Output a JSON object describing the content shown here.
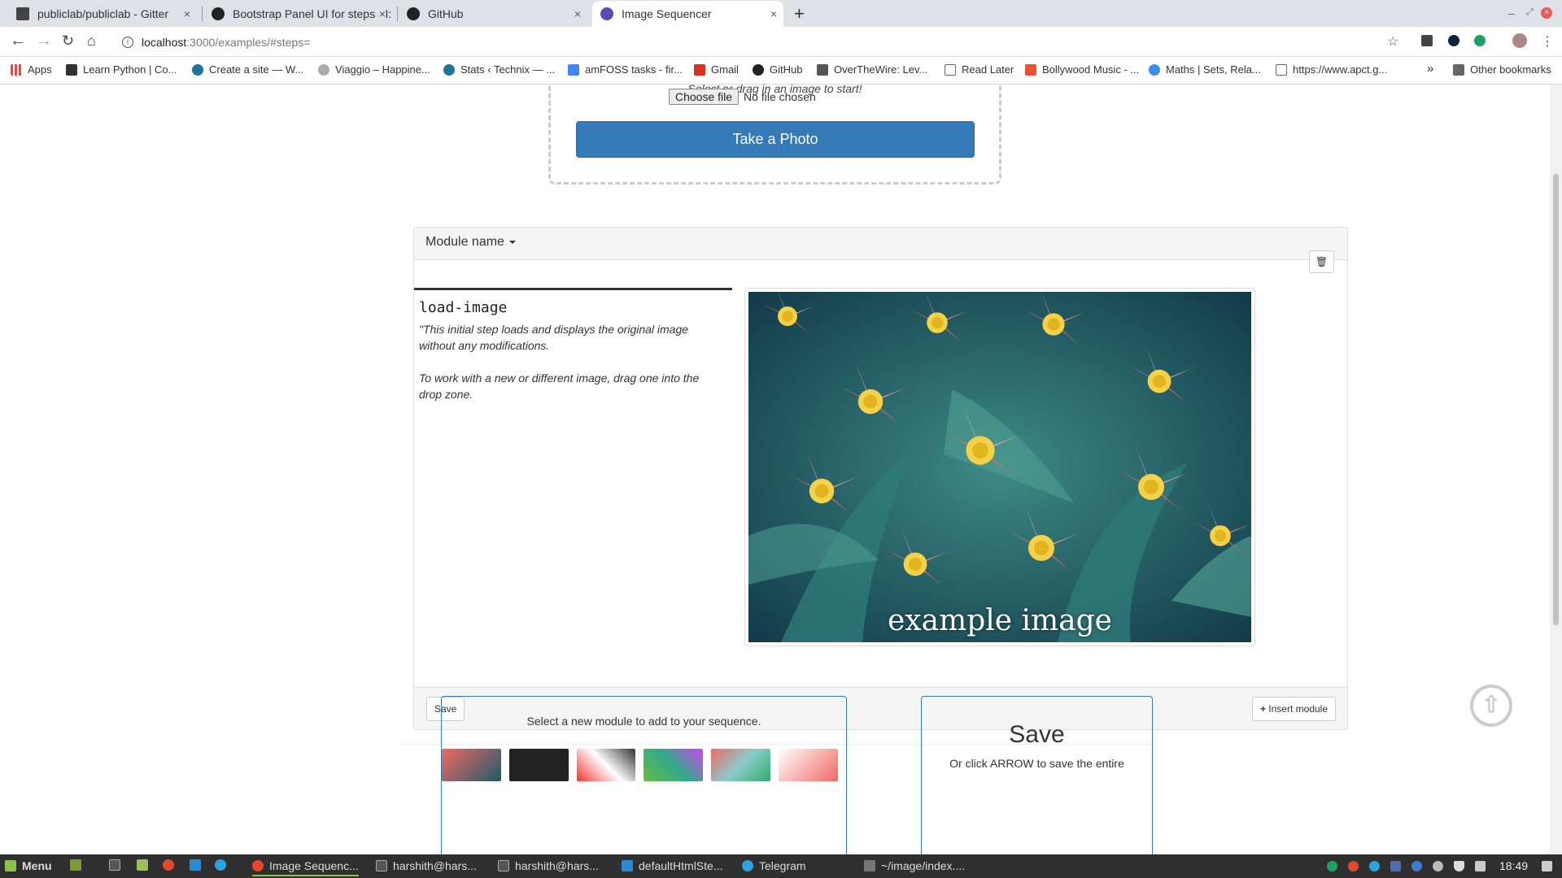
{
  "browser": {
    "tabs": [
      {
        "title": "publiclab/publiclab - Gitter",
        "icon": "gitter-icon"
      },
      {
        "title": "Bootstrap Panel UI for steps · I:",
        "icon": "github-icon"
      },
      {
        "title": "GitHub",
        "icon": "github-icon"
      },
      {
        "title": "Image Sequencer",
        "icon": "image-sequencer-icon"
      }
    ],
    "close_glyph": "×",
    "new_tab_glyph": "+",
    "url_host": "localhost",
    "url_path": ":3000/examples/#steps=",
    "bookmarks": [
      {
        "label": "Apps",
        "icon": "apps-grid-icon"
      },
      {
        "label": "Learn Python | Co...",
        "icon": "python-icon"
      },
      {
        "label": "Create a site — W...",
        "icon": "wordpress-icon"
      },
      {
        "label": "Viaggio – Happine...",
        "icon": "wordpress-icon"
      },
      {
        "label": "Stats ‹ Technix — ...",
        "icon": "wordpress-icon"
      },
      {
        "label": "amFOSS tasks - fir...",
        "icon": "docs-icon"
      },
      {
        "label": "Gmail",
        "icon": "gmail-icon"
      },
      {
        "label": "GitHub",
        "icon": "github-icon"
      },
      {
        "label": "OverTheWire: Lev...",
        "icon": "overthewire-icon"
      },
      {
        "label": "Read Later",
        "icon": "page-icon"
      },
      {
        "label": "Bollywood Music - ...",
        "icon": "music-icon"
      },
      {
        "label": "Maths | Sets, Rela...",
        "icon": "maths-icon"
      },
      {
        "label": "https://www.apct.g...",
        "icon": "page-icon"
      }
    ],
    "more_glyph": "»",
    "other_bookmarks": "Other bookmarks"
  },
  "dropzone": {
    "prompt": "Select or drag in an image to start!",
    "choose_file": "Choose file",
    "no_file": "No file chosen",
    "take_photo": "Take a Photo"
  },
  "step_panel": {
    "module_menu": "Module name",
    "delete_glyph": "🗑",
    "module_name": "load-image",
    "description_1": "\"This initial step loads and displays the original image without any modifications.",
    "description_2": "To work with a new or different image, drag one into the drop zone.",
    "image_overlay": "example image",
    "save": "Save",
    "insert_module": "Insert module",
    "insert_glyph": "+"
  },
  "add_module": {
    "prompt": "Select a new module to add to your sequence."
  },
  "save_box": {
    "title": "Save",
    "subtitle": "Or click ARROW to save the entire"
  },
  "to_top_glyph": "⇧",
  "taskbar": {
    "menu": "Menu",
    "tasks": [
      {
        "label": "Image Sequenc...",
        "icon": "chrome-icon",
        "active": true
      },
      {
        "label": "harshith@hars...",
        "icon": "terminal-icon"
      },
      {
        "label": "harshith@hars...",
        "icon": "terminal-icon"
      },
      {
        "label": "defaultHtmlSte...",
        "icon": "vscode-icon"
      },
      {
        "label": "Telegram",
        "icon": "telegram-icon"
      },
      {
        "label": "~/image/index....",
        "icon": "editor-icon"
      }
    ],
    "clock": "18:49"
  }
}
